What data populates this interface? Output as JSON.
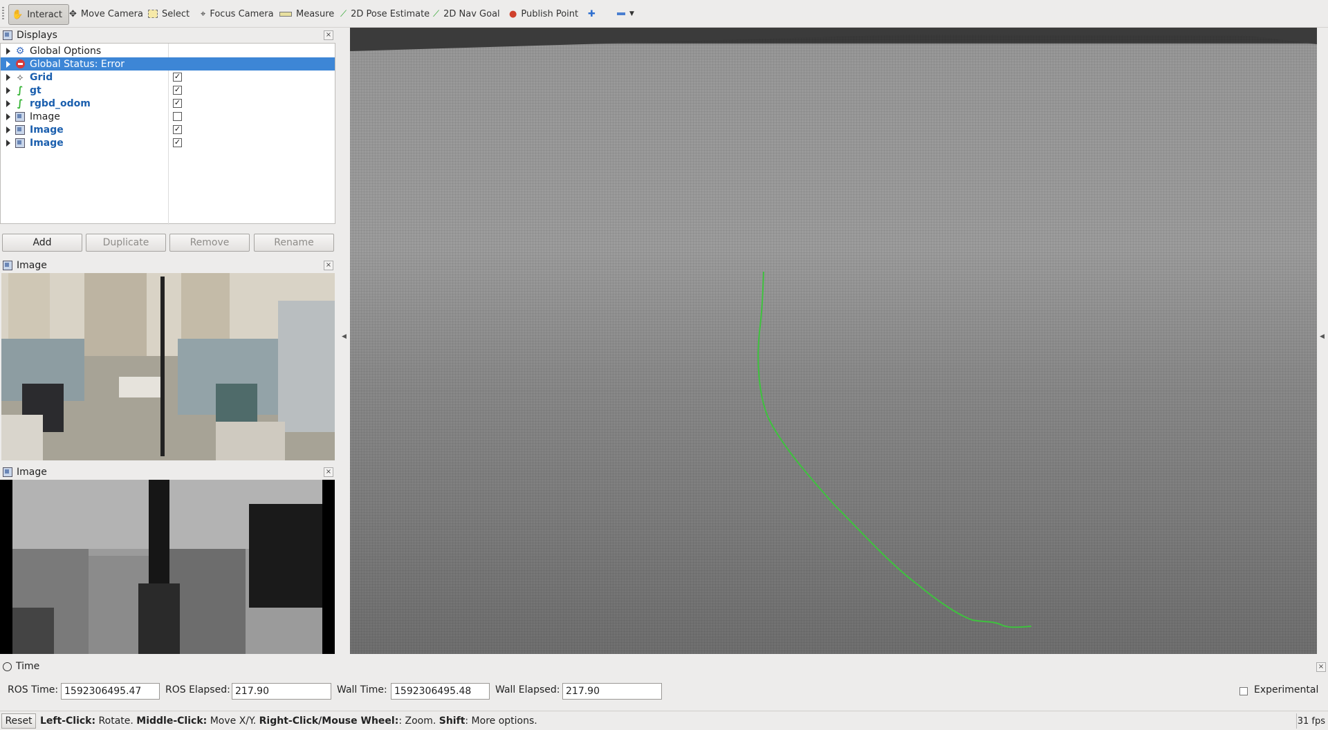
{
  "toolbar": {
    "tools": [
      "Interact",
      "Move Camera",
      "Select",
      "Focus Camera",
      "Measure",
      "2D Pose Estimate",
      "2D Nav Goal",
      "Publish Point"
    ],
    "active_tool": "Interact"
  },
  "displays": {
    "title": "Displays",
    "items": [
      {
        "label": "Global Options",
        "icon": "gear-icon",
        "checked": null,
        "style": "normal"
      },
      {
        "label": "Global Status: Error",
        "icon": "error-icon",
        "checked": null,
        "style": "selected"
      },
      {
        "label": "Grid",
        "icon": "grid-icon",
        "checked": true,
        "style": "blue"
      },
      {
        "label": "gt",
        "icon": "path-icon",
        "checked": true,
        "style": "blue"
      },
      {
        "label": "rgbd_odom",
        "icon": "path-icon",
        "checked": true,
        "style": "blue"
      },
      {
        "label": "Image",
        "icon": "image-icon",
        "checked": false,
        "style": "normal"
      },
      {
        "label": "Image",
        "icon": "image-icon",
        "checked": true,
        "style": "blue"
      },
      {
        "label": "Image",
        "icon": "image-icon",
        "checked": true,
        "style": "blue"
      }
    ],
    "buttons": {
      "add": "Add",
      "duplicate": "Duplicate",
      "remove": "Remove",
      "rename": "Rename"
    }
  },
  "image_panel_rgb": {
    "title": "Image"
  },
  "image_panel_depth": {
    "title": "Image"
  },
  "time": {
    "title": "Time",
    "ros_time_label": "ROS Time:",
    "ros_time": "1592306495.47",
    "ros_elapsed_label": "ROS Elapsed:",
    "ros_elapsed": "217.90",
    "wall_time_label": "Wall Time:",
    "wall_time": "1592306495.48",
    "wall_elapsed_label": "Wall Elapsed:",
    "wall_elapsed": "217.90",
    "experimental_label": "Experimental"
  },
  "status": {
    "reset": "Reset",
    "hint_left_click": "Left-Click:",
    "hint_rotate": " Rotate. ",
    "hint_middle_click": "Middle-Click:",
    "hint_move": " Move X/Y. ",
    "hint_right_click": "Right-Click/Mouse Wheel:",
    "hint_zoom": ": Zoom. ",
    "hint_shift": "Shift",
    "hint_more": ": More options.",
    "fps": "31 fps"
  },
  "colors": {
    "selection": "#3d86d6",
    "path": "#3ec23e",
    "blue_label": "#1b5fae"
  }
}
